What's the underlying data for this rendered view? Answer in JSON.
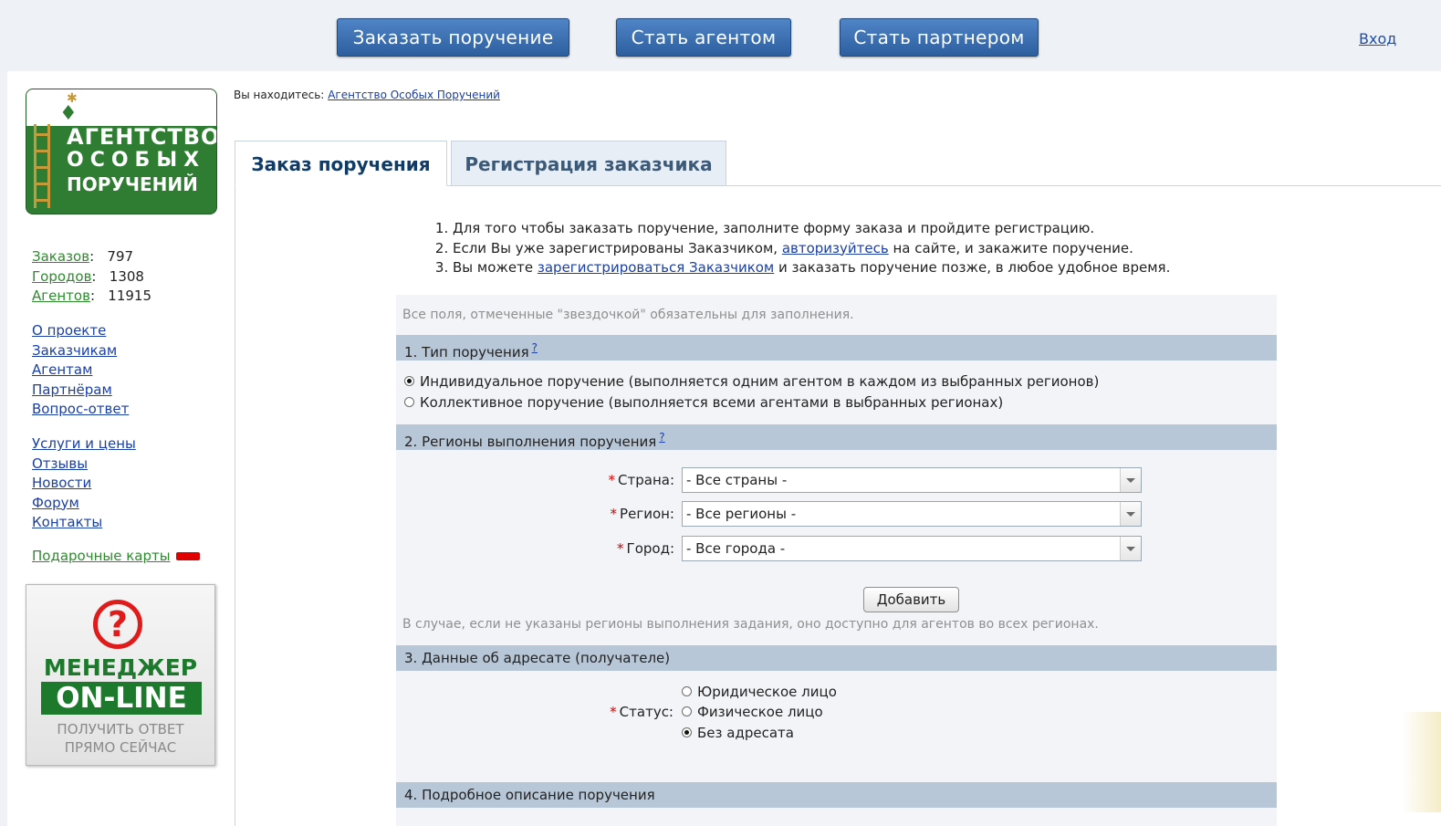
{
  "topbar": {
    "buttons": [
      "Заказать поручение",
      "Стать агентом",
      "Стать партнером"
    ],
    "login": "Вход"
  },
  "logo": {
    "line1": "АГЕНТСТВО",
    "line2": "ОСОБЫХ",
    "line3": "ПОРУЧЕНИЙ"
  },
  "stats": [
    {
      "label": "Заказов",
      "value": "797"
    },
    {
      "label": "Городов",
      "value": "1308"
    },
    {
      "label": "Агентов",
      "value": "11915"
    }
  ],
  "nav1": [
    "О проекте",
    "Заказчикам",
    "Агентам",
    "Партнёрам",
    "Вопрос-ответ"
  ],
  "nav2": [
    "Услуги и цены",
    "Отзывы",
    "Новости",
    "Форум",
    "Контакты"
  ],
  "gift": "Подарочные карты",
  "manager": {
    "line1": "МЕНЕДЖЕР",
    "line2": "ON-LINE",
    "line3": "ПОЛУЧИТЬ ОТВЕТ",
    "line4": "ПРЯМО СЕЙЧАС"
  },
  "breadcrumb": {
    "prefix": "Вы находитесь:",
    "link": "Агентство Особых Поручений"
  },
  "tabs": {
    "active": "Заказ поручения",
    "inactive": "Регистрация заказчика"
  },
  "instructions": {
    "i1": "Для того чтобы заказать поручение, заполните форму заказа и пройдите регистрацию.",
    "i2_before": "Если Вы уже зарегистрированы Заказчиком,",
    "i2_link": "авторизуйтесь",
    "i2_after": "на сайте, и закажите поручение.",
    "i3_before": "Вы можете",
    "i3_link": "зарегистрироваться Заказчиком",
    "i3_after": "и заказать поручение позже, в любое удобное время."
  },
  "required_note": "Все поля, отмеченные \"звездочкой\" обязательны для заполнения.",
  "section1": {
    "title": "1.  Тип поручения",
    "help": "?",
    "options": [
      {
        "label": "Индивидуальное поручение (выполняется одним агентом в каждом из выбранных регионов)",
        "checked": true
      },
      {
        "label": "Коллективное поручение (выполняется всеми агентами в  выбранных регионах)",
        "checked": false
      }
    ]
  },
  "section2": {
    "title": "2.  Регионы выполнения поручения",
    "help": "?",
    "country_label": "Страна:",
    "country_value": "- Все страны -",
    "region_label": "Регион:",
    "region_value": "- Все регионы -",
    "city_label": "Город:",
    "city_value": "- Все города -",
    "add_button": "Добавить",
    "note": "В случае, если не указаны регионы выполнения задания, оно доступно для агентов во всех регионах."
  },
  "section3": {
    "title": "3.  Данные об адресате (получателе)",
    "status_label": "Статус:",
    "options": [
      {
        "label": "Юридическое лицо",
        "checked": false
      },
      {
        "label": "Физическое лицо",
        "checked": false
      },
      {
        "label": "Без адресата",
        "checked": true
      }
    ]
  },
  "section4": {
    "title": "4.  Подробное описание поручения"
  },
  "colors": {
    "brand_green": "#2e7d32",
    "button_blue": "#3a6fb3",
    "section_bar": "#b8c7d7",
    "required_red": "#d40000"
  }
}
